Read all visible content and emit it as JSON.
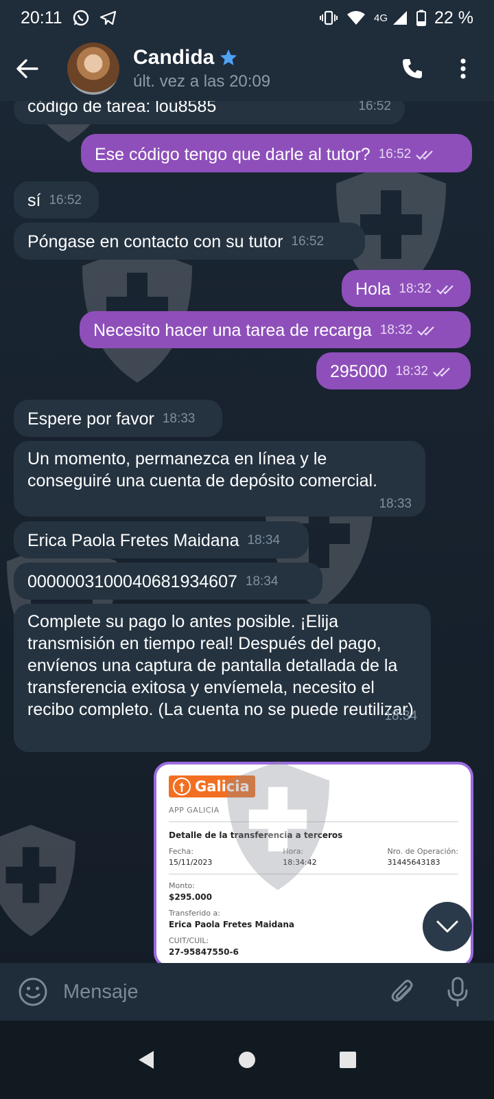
{
  "status_bar": {
    "time": "20:11",
    "network": "4G",
    "battery": "22 %",
    "icons": [
      "whatsapp-icon",
      "telegram-icon",
      "vibrate-icon",
      "wifi-icon",
      "signal-icon",
      "battery-icon"
    ]
  },
  "header": {
    "contact_name": "Candida",
    "last_seen": "últ. vez a las 20:09",
    "icons": [
      "back-arrow-icon",
      "verified-star-icon",
      "phone-icon",
      "more-vert-icon"
    ]
  },
  "messages": [
    {
      "dir": "in",
      "text": "código de tarea: lou8585",
      "time": "16:52"
    },
    {
      "dir": "out",
      "text": "Ese código tengo que darle al tutor?",
      "time": "16:52",
      "read": true
    },
    {
      "dir": "in",
      "text": "sí",
      "time": "16:52"
    },
    {
      "dir": "in",
      "text": "Póngase en contacto con su tutor",
      "time": "16:52"
    },
    {
      "dir": "out",
      "text": "Hola",
      "time": "18:32",
      "read": true
    },
    {
      "dir": "out",
      "text": "Necesito hacer una tarea de recarga",
      "time": "18:32",
      "read": true
    },
    {
      "dir": "out",
      "text": "295000",
      "time": "18:32",
      "read": true
    },
    {
      "dir": "in",
      "text": "Espere por favor",
      "time": "18:33"
    },
    {
      "dir": "in",
      "text": "Un momento, permanezca en línea y le conseguiré una cuenta de depósito comercial.",
      "time": "18:33"
    },
    {
      "dir": "in",
      "text": "Erica Paola Fretes Maidana",
      "time": "18:34"
    },
    {
      "dir": "in",
      "text": "0000003100040681934607",
      "time": "18:34"
    },
    {
      "dir": "in",
      "text": "Complete su pago lo antes posible. ¡Elija transmisión en tiempo real! Después del pago, envíenos una captura de pantalla detallada de la transferencia exitosa y envíemela, necesito el recibo completo. (La cuenta no se puede reutilizar)",
      "time": "18:34"
    }
  ],
  "receipt": {
    "brand": "Galicia",
    "app_label": "APP GALICIA",
    "title": "Detalle de la transferencia a terceros",
    "fecha_label": "Fecha:",
    "fecha": "15/11/2023",
    "hora_label": "Hora:",
    "hora": "18:34:42",
    "operacion_label": "Nro. de Operación:",
    "operacion": "31445643183",
    "monto_label": "Monto:",
    "monto": "$295.000",
    "transferido_label": "Transferido a:",
    "transferido": "Erica Paola Fretes Maidana",
    "cuit_label": "CUIT/CUIL:",
    "cuit": "27-95847550-6"
  },
  "input": {
    "placeholder": "Mensaje",
    "icons": [
      "emoji-icon",
      "attach-icon",
      "mic-icon"
    ]
  },
  "colors": {
    "background": "#17212b",
    "header": "#1f2c3a",
    "incoming_bubble": "#253340",
    "outgoing_bubble": "#8e4fba",
    "accent_blue": "#4fa3f7"
  }
}
